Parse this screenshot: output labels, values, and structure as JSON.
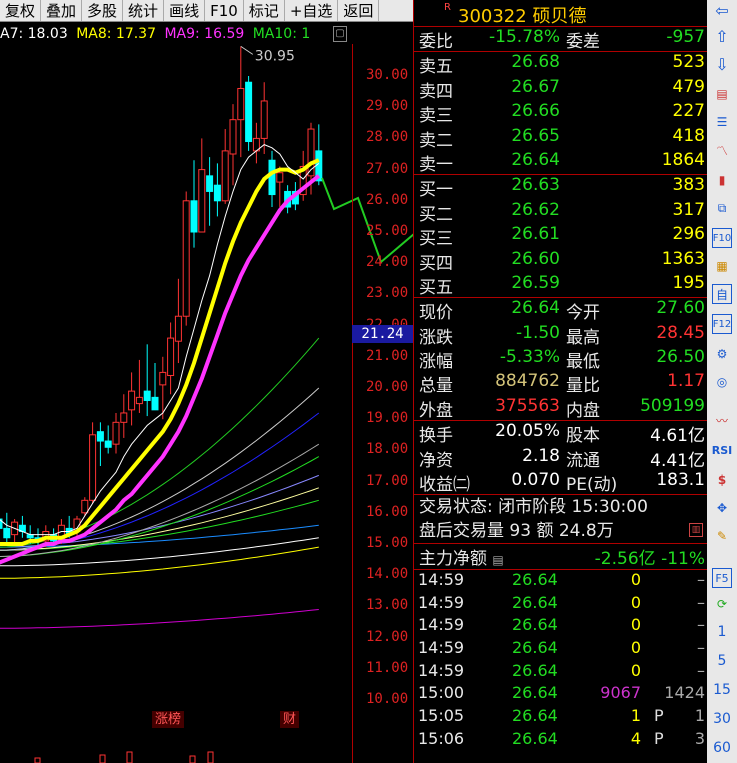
{
  "toolbar": {
    "items": [
      "复权",
      "叠加",
      "多股",
      "统计",
      "画线",
      "F10",
      "标记",
      "+自选",
      "返回"
    ]
  },
  "ma": {
    "ma7": "A7: 18.03",
    "ma8": "MA8: 17.37",
    "ma9": "MA9: 16.59",
    "ma10": "MA10: 1"
  },
  "chart": {
    "high_label": "30.95",
    "current_price": "21.24",
    "price_axis": [
      "30.00",
      "29.00",
      "28.00",
      "27.00",
      "26.00",
      "25.00",
      "24.00",
      "23.00",
      "22.00",
      "21.00",
      "20.00",
      "19.00",
      "18.00",
      "17.00",
      "16.00",
      "15.00",
      "14.00",
      "13.00",
      "12.00",
      "11.00",
      "10.00"
    ],
    "tags": {
      "zhangbang": "涨榜",
      "cai": "财"
    }
  },
  "chart_data": {
    "type": "candlestick",
    "ylim": [
      10,
      31
    ],
    "candles": [
      {
        "o": 15.8,
        "h": 16.1,
        "l": 15.3,
        "c": 15.5
      },
      {
        "o": 15.5,
        "h": 16.0,
        "l": 15.0,
        "c": 15.2
      },
      {
        "o": 15.3,
        "h": 15.8,
        "l": 15.0,
        "c": 15.7
      },
      {
        "o": 15.6,
        "h": 15.9,
        "l": 15.2,
        "c": 15.4
      },
      {
        "o": 15.3,
        "h": 15.6,
        "l": 15.0,
        "c": 15.2
      },
      {
        "o": 15.2,
        "h": 15.5,
        "l": 14.9,
        "c": 15.1
      },
      {
        "o": 15.1,
        "h": 15.6,
        "l": 14.9,
        "c": 15.4
      },
      {
        "o": 15.3,
        "h": 15.5,
        "l": 15.0,
        "c": 15.1
      },
      {
        "o": 15.1,
        "h": 15.8,
        "l": 15.0,
        "c": 15.6
      },
      {
        "o": 15.5,
        "h": 15.9,
        "l": 15.2,
        "c": 15.3
      },
      {
        "o": 15.4,
        "h": 15.9,
        "l": 15.2,
        "c": 15.8
      },
      {
        "o": 16.0,
        "h": 16.5,
        "l": 15.9,
        "c": 16.4
      },
      {
        "o": 16.4,
        "h": 18.9,
        "l": 16.3,
        "c": 18.5
      },
      {
        "o": 18.6,
        "h": 18.9,
        "l": 17.5,
        "c": 18.3
      },
      {
        "o": 18.3,
        "h": 18.8,
        "l": 17.9,
        "c": 18.1
      },
      {
        "o": 18.2,
        "h": 19.2,
        "l": 17.9,
        "c": 18.9
      },
      {
        "o": 18.9,
        "h": 19.8,
        "l": 18.4,
        "c": 19.2
      },
      {
        "o": 19.3,
        "h": 20.5,
        "l": 18.8,
        "c": 19.9
      },
      {
        "o": 19.5,
        "h": 20.9,
        "l": 19.2,
        "c": 19.7
      },
      {
        "o": 19.9,
        "h": 21.4,
        "l": 19.1,
        "c": 19.6
      },
      {
        "o": 19.7,
        "h": 20.8,
        "l": 19.3,
        "c": 19.3
      },
      {
        "o": 20.1,
        "h": 21.0,
        "l": 19.0,
        "c": 20.5
      },
      {
        "o": 20.4,
        "h": 22.1,
        "l": 19.8,
        "c": 21.6
      },
      {
        "o": 21.5,
        "h": 23.5,
        "l": 20.8,
        "c": 22.3
      },
      {
        "o": 22.3,
        "h": 26.3,
        "l": 22.0,
        "c": 26.0
      },
      {
        "o": 26.0,
        "h": 27.3,
        "l": 24.5,
        "c": 25.0
      },
      {
        "o": 25.0,
        "h": 28.0,
        "l": 25.1,
        "c": 27.0
      },
      {
        "o": 26.8,
        "h": 27.4,
        "l": 25.2,
        "c": 26.3
      },
      {
        "o": 26.5,
        "h": 27.2,
        "l": 25.5,
        "c": 26.0
      },
      {
        "o": 26.0,
        "h": 28.3,
        "l": 25.9,
        "c": 27.6
      },
      {
        "o": 27.5,
        "h": 29.1,
        "l": 26.5,
        "c": 28.6
      },
      {
        "o": 28.6,
        "h": 30.95,
        "l": 27.4,
        "c": 29.6
      },
      {
        "o": 29.8,
        "h": 30.0,
        "l": 27.6,
        "c": 27.9
      },
      {
        "o": 27.6,
        "h": 28.5,
        "l": 27.2,
        "c": 28.0
      },
      {
        "o": 28.0,
        "h": 29.8,
        "l": 27.5,
        "c": 29.2
      },
      {
        "o": 27.3,
        "h": 27.6,
        "l": 25.8,
        "c": 26.2
      },
      {
        "o": 26.6,
        "h": 27.1,
        "l": 25.8,
        "c": 26.9
      },
      {
        "o": 26.3,
        "h": 26.5,
        "l": 25.6,
        "c": 25.8
      },
      {
        "o": 26.3,
        "h": 26.6,
        "l": 25.7,
        "c": 25.9
      },
      {
        "o": 26.2,
        "h": 27.6,
        "l": 26.0,
        "c": 27.1
      },
      {
        "o": 26.8,
        "h": 28.5,
        "l": 26.2,
        "c": 28.3
      },
      {
        "o": 27.6,
        "h": 28.45,
        "l": 26.5,
        "c": 26.64
      }
    ],
    "ma7": [
      15.8,
      15.6,
      15.5,
      15.4,
      15.3,
      15.3,
      15.3,
      15.3,
      15.4,
      15.4,
      15.5,
      15.9,
      16.3,
      16.7,
      17.0,
      17.3,
      17.8,
      18.2,
      18.5,
      18.8,
      19.0,
      19.2,
      19.6,
      20.0,
      21.0,
      21.9,
      22.8,
      23.6,
      24.6,
      25.5,
      26.3,
      27.0,
      27.4,
      27.6,
      27.8,
      27.7,
      27.5,
      27.1,
      26.9,
      26.7,
      27.0,
      27.2
    ],
    "ma8": [
      15.0,
      15.0,
      15.0,
      15.0,
      15.1,
      15.1,
      15.2,
      15.2,
      15.2,
      15.3,
      15.4,
      15.6,
      15.9,
      16.2,
      16.5,
      16.8,
      17.1,
      17.4,
      17.7,
      18.0,
      18.3,
      18.6,
      19.0,
      19.5,
      20.1,
      20.8,
      21.6,
      22.4,
      23.2,
      24.0,
      24.7,
      25.3,
      25.8,
      26.3,
      26.7,
      26.9,
      27.0,
      27.0,
      26.9,
      27.0,
      27.2,
      27.3
    ],
    "ma9": [
      14.4,
      14.5,
      14.6,
      14.7,
      14.8,
      14.9,
      15.0,
      15.0,
      15.1,
      15.1,
      15.2,
      15.3,
      15.5,
      15.7,
      15.9,
      16.1,
      16.4,
      16.6,
      16.9,
      17.2,
      17.5,
      17.8,
      18.2,
      18.6,
      19.1,
      19.7,
      20.3,
      21.0,
      21.7,
      22.4,
      23.0,
      23.6,
      24.1,
      24.5,
      24.9,
      25.3,
      25.7,
      26.0,
      26.2,
      26.4,
      26.6,
      26.8
    ]
  },
  "stock": {
    "r": "R",
    "code": "300322",
    "name": "硕贝德"
  },
  "order_book": {
    "weibi": {
      "label": "委比",
      "value": "-15.78%",
      "label2": "委差",
      "value2": "-957"
    },
    "asks": [
      {
        "label": "卖五",
        "price": "26.68",
        "vol": "523"
      },
      {
        "label": "卖四",
        "price": "26.67",
        "vol": "479"
      },
      {
        "label": "卖三",
        "price": "26.66",
        "vol": "227"
      },
      {
        "label": "卖二",
        "price": "26.65",
        "vol": "418"
      },
      {
        "label": "卖一",
        "price": "26.64",
        "vol": "1864"
      }
    ],
    "bids": [
      {
        "label": "买一",
        "price": "26.63",
        "vol": "383"
      },
      {
        "label": "买二",
        "price": "26.62",
        "vol": "317"
      },
      {
        "label": "买三",
        "price": "26.61",
        "vol": "296"
      },
      {
        "label": "买四",
        "price": "26.60",
        "vol": "1363"
      },
      {
        "label": "买五",
        "price": "26.59",
        "vol": "195"
      }
    ]
  },
  "quote": {
    "rows": [
      {
        "l1": "现价",
        "v1": "26.64",
        "c1": "green",
        "l2": "今开",
        "v2": "27.60",
        "c2": "green"
      },
      {
        "l1": "涨跌",
        "v1": "-1.50",
        "c1": "green",
        "l2": "最高",
        "v2": "28.45",
        "c2": "red"
      },
      {
        "l1": "涨幅",
        "v1": "-5.33%",
        "c1": "green",
        "l2": "最低",
        "v2": "26.50",
        "c2": "green"
      },
      {
        "l1": "总量",
        "v1": "884762",
        "c1": "gold",
        "l2": "量比",
        "v2": "1.17",
        "c2": "red"
      },
      {
        "l1": "外盘",
        "v1": "375563",
        "c1": "red",
        "l2": "内盘",
        "v2": "509199",
        "c2": "green"
      }
    ],
    "rows2": [
      {
        "l1": "换手",
        "v1": "20.05%",
        "l2": "股本",
        "v2": "4.61亿"
      },
      {
        "l1": "净资",
        "v1": "2.18",
        "l2": "流通",
        "v2": "4.41亿"
      },
      {
        "l1": "收益㈡",
        "v1": "0.070",
        "l2": "PE(动)",
        "v2": "183.1"
      }
    ]
  },
  "status": {
    "trade": "交易状态: 闭市阶段 15:30:00",
    "after": "盘后交易量 93 额 24.8万"
  },
  "fund": {
    "label": "主力净额",
    "value": "-2.56亿",
    "pct": "-11%"
  },
  "ticks": [
    {
      "t": "14:59",
      "p": "26.64",
      "v": "0",
      "vc": "yellow",
      "f": "",
      "n": "–"
    },
    {
      "t": "14:59",
      "p": "26.64",
      "v": "0",
      "vc": "yellow",
      "f": "",
      "n": "–"
    },
    {
      "t": "14:59",
      "p": "26.64",
      "v": "0",
      "vc": "yellow",
      "f": "",
      "n": "–"
    },
    {
      "t": "14:59",
      "p": "26.64",
      "v": "0",
      "vc": "yellow",
      "f": "",
      "n": "–"
    },
    {
      "t": "14:59",
      "p": "26.64",
      "v": "0",
      "vc": "yellow",
      "f": "",
      "n": "–"
    },
    {
      "t": "15:00",
      "p": "26.64",
      "v": "9067",
      "vc": "purple",
      "f": "",
      "n": "1424"
    },
    {
      "t": "15:05",
      "p": "26.64",
      "v": "1",
      "vc": "yellow",
      "f": "P",
      "n": "1"
    },
    {
      "t": "15:06",
      "p": "26.64",
      "v": "4",
      "vc": "yellow",
      "f": "P",
      "n": "3"
    }
  ],
  "sidebar": {
    "nums": [
      "1",
      "5",
      "15",
      "30",
      "60"
    ],
    "rsi": "RSI",
    "f5": "F5",
    "f10": "F10",
    "f12": "F12",
    "zi": "自"
  }
}
